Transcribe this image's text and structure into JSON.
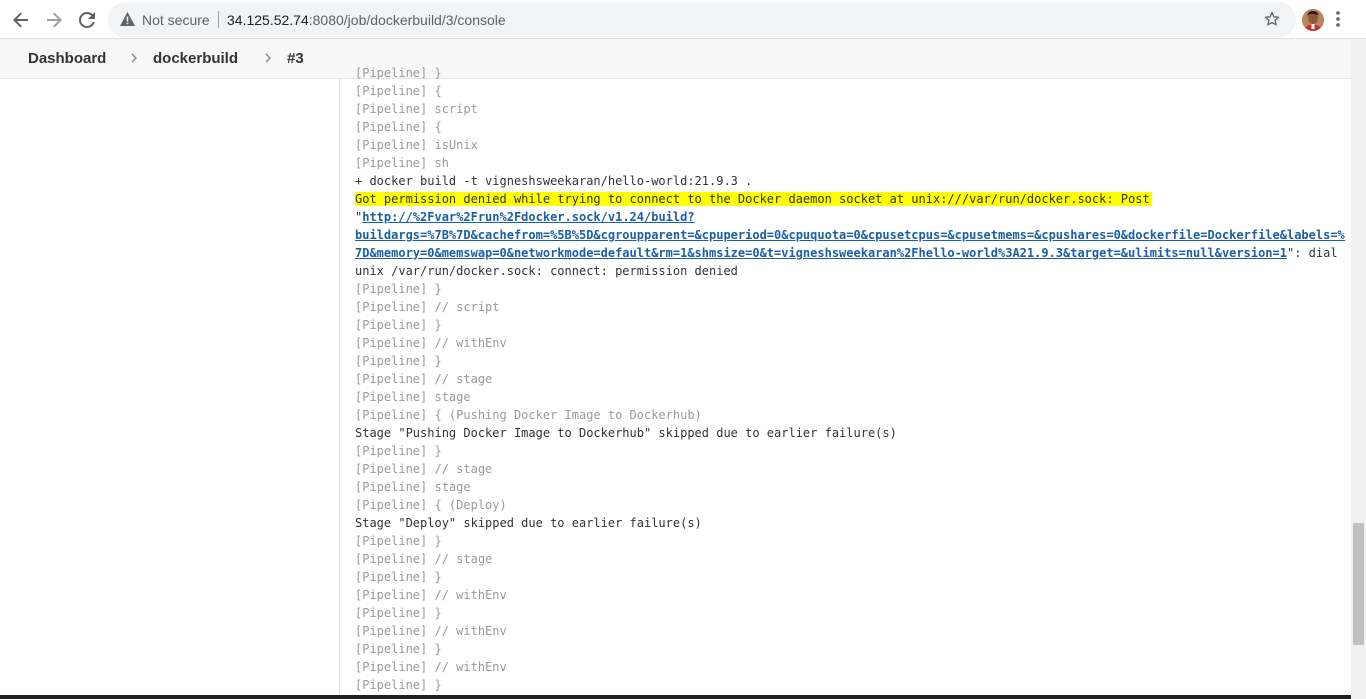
{
  "browser": {
    "security_text": "Not secure",
    "url_host": "34.125.52.74",
    "url_path": ":8080/job/dockerbuild/3/console"
  },
  "breadcrumbs": [
    "Dashboard",
    "dockerbuild",
    "#3"
  ],
  "console": {
    "lines_top": [
      {
        "text": "[Pipeline] {",
        "kind": "pipeline"
      },
      {
        "text": "[Pipeline] script",
        "kind": "pipeline"
      },
      {
        "text": "[Pipeline] {",
        "kind": "pipeline"
      },
      {
        "text": "[Pipeline] isUnix",
        "kind": "pipeline"
      },
      {
        "text": "[Pipeline] sh",
        "kind": "pipeline"
      },
      {
        "text": "+ docker build -t vigneshsweekaran/hello-world:21.9.3 .",
        "kind": "output"
      }
    ],
    "error_highlight": "Got permission denied while trying to connect to the Docker daemon socket at unix:///var/run/docker.sock: Post",
    "link_prefix": "\"",
    "link_line1": "http://%2Fvar%2Frun%2Fdocker.sock/v1.24/build?",
    "link_line2": "buildargs=%7B%7D&cachefrom=%5B%5D&cgroupparent=&cpuperiod=0&cpuquota=0&cpusetcpus=&cpusetmems=&cpushares=0&dockerfile=Dockerfile&labels=%7B%",
    "link_line3": "7D&memory=0&memswap=0&networkmode=default&rm=1&shmsize=0&t=vigneshsweekaran%2Fhello-world%3A21.9.3&target=&ulimits=null&version=1",
    "link_suffix": "\": dial",
    "error_tail": "unix /var/run/docker.sock: connect: permission denied",
    "lines_bottom": [
      {
        "text": "[Pipeline] }",
        "kind": "pipeline"
      },
      {
        "text": "[Pipeline] // script",
        "kind": "pipeline"
      },
      {
        "text": "[Pipeline] }",
        "kind": "pipeline"
      },
      {
        "text": "[Pipeline] // withEnv",
        "kind": "pipeline"
      },
      {
        "text": "[Pipeline] }",
        "kind": "pipeline"
      },
      {
        "text": "[Pipeline] // stage",
        "kind": "pipeline"
      },
      {
        "text": "[Pipeline] stage",
        "kind": "pipeline"
      },
      {
        "text": "[Pipeline] { (Pushing Docker Image to Dockerhub)",
        "kind": "pipeline"
      },
      {
        "text": "Stage \"Pushing Docker Image to Dockerhub\" skipped due to earlier failure(s)",
        "kind": "output"
      },
      {
        "text": "[Pipeline] }",
        "kind": "pipeline"
      },
      {
        "text": "[Pipeline] // stage",
        "kind": "pipeline"
      },
      {
        "text": "[Pipeline] stage",
        "kind": "pipeline"
      },
      {
        "text": "[Pipeline] { (Deploy)",
        "kind": "pipeline"
      },
      {
        "text": "Stage \"Deploy\" skipped due to earlier failure(s)",
        "kind": "output"
      },
      {
        "text": "[Pipeline] }",
        "kind": "pipeline"
      },
      {
        "text": "[Pipeline] // stage",
        "kind": "pipeline"
      },
      {
        "text": "[Pipeline] }",
        "kind": "pipeline"
      },
      {
        "text": "[Pipeline] // withEnv",
        "kind": "pipeline"
      },
      {
        "text": "[Pipeline] }",
        "kind": "pipeline"
      },
      {
        "text": "[Pipeline] // withEnv",
        "kind": "pipeline"
      },
      {
        "text": "[Pipeline] }",
        "kind": "pipeline"
      },
      {
        "text": "[Pipeline] // withEnv",
        "kind": "pipeline"
      },
      {
        "text": "[Pipeline] }",
        "kind": "pipeline"
      }
    ]
  },
  "icons": {
    "back": "arrow-left-icon",
    "forward": "arrow-right-icon",
    "reload": "reload-icon",
    "security": "warning-triangle-icon",
    "bookmark": "star-icon",
    "menu": "kebab-menu-icon",
    "crumb_separator": "chevron-right-icon"
  },
  "colors": {
    "highlight": "#ffff00",
    "link": "#1a5fa8",
    "pipeline_text": "#9a9a9a",
    "output_text": "#333333"
  }
}
